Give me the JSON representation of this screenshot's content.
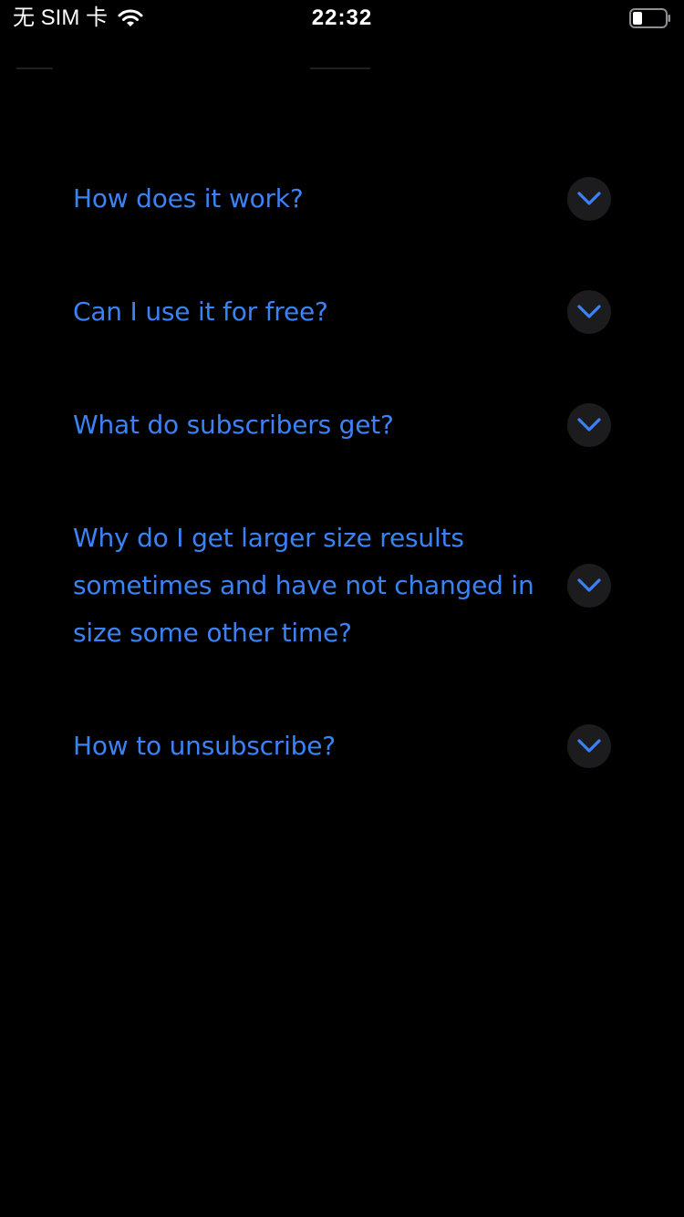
{
  "status_bar": {
    "carrier": "无 SIM 卡",
    "time": "22:32",
    "wifi_icon": "wifi-icon",
    "battery_icon": "battery-icon"
  },
  "colors": {
    "background": "#000000",
    "accent": "#3b82f6",
    "toggle_background": "#1c1c1e"
  },
  "faq": {
    "items": [
      {
        "question": "How does it work?",
        "expanded": false,
        "icon": "chevron-down-icon"
      },
      {
        "question": "Can I use it for free?",
        "expanded": false,
        "icon": "chevron-down-icon"
      },
      {
        "question": "What do subscribers get?",
        "expanded": false,
        "icon": "chevron-down-icon"
      },
      {
        "question": "Why do I get larger size results sometimes and have not changed in size some other time?",
        "expanded": false,
        "icon": "chevron-down-icon"
      },
      {
        "question": "How to unsubscribe?",
        "expanded": false,
        "icon": "chevron-down-icon"
      }
    ]
  }
}
